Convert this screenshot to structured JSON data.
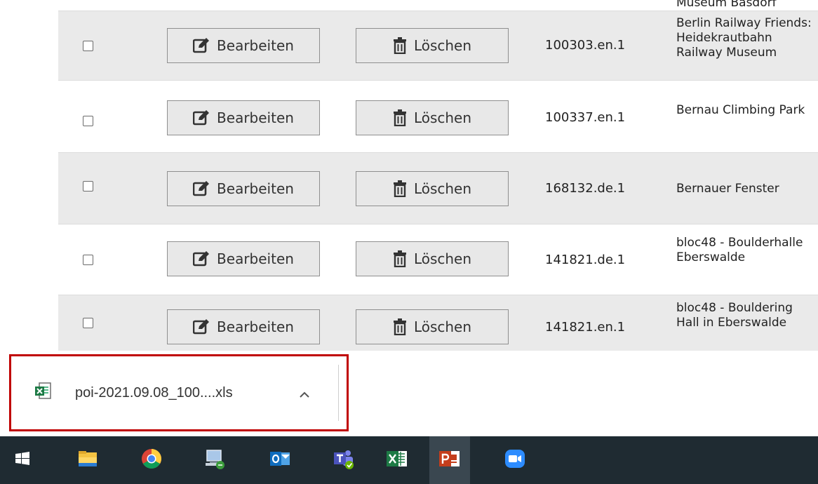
{
  "table": {
    "partial_top_name": "Museum Basdorf",
    "rows": [
      {
        "edit_label": "Bearbeiten",
        "delete_label": "Löschen",
        "id": "100303.en.1",
        "name": "Berlin Railway Friends: Heidekrautbahn Railway Museum"
      },
      {
        "edit_label": "Bearbeiten",
        "delete_label": "Löschen",
        "id": "100337.en.1",
        "name": "Bernau Climbing Park"
      },
      {
        "edit_label": "Bearbeiten",
        "delete_label": "Löschen",
        "id": "168132.de.1",
        "name": "Bernauer Fenster"
      },
      {
        "edit_label": "Bearbeiten",
        "delete_label": "Löschen",
        "id": "141821.de.1",
        "name": "bloc48 - Boulderhalle Eberswalde"
      },
      {
        "edit_label": "Bearbeiten",
        "delete_label": "Löschen",
        "id": "141821.en.1",
        "name": "bloc48 - Bouldering Hall in Eberswalde"
      }
    ]
  },
  "download": {
    "file_name": "poi-2021.09.08_100....xls",
    "icon": "excel-file-icon",
    "highlight_color": "#c00000"
  },
  "taskbar": {
    "icons": [
      "windows-start-icon",
      "file-explorer-icon",
      "chrome-icon",
      "network-app-icon",
      "outlook-icon",
      "teams-icon",
      "excel-icon",
      "powerpoint-icon",
      "zoom-icon"
    ],
    "background": "#1f2b32"
  }
}
